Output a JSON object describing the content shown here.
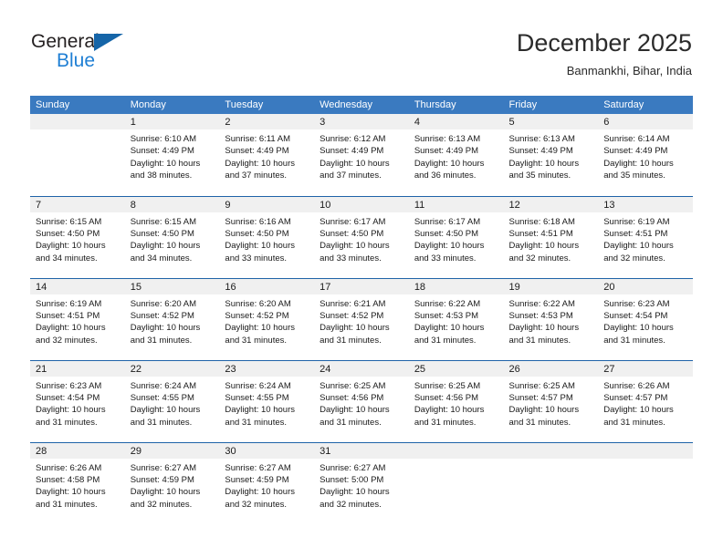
{
  "logo": {
    "word_one": "General",
    "word_two": "Blue",
    "triangle_icon": "blue-triangle-icon",
    "brand_blue": "#1f7fd4",
    "triangle_color": "#1565a8"
  },
  "header": {
    "title": "December 2025",
    "subtitle": "Banmankhi, Bihar, India"
  },
  "theme": {
    "header_row_bg": "#3a7ac0",
    "row_divider": "#1f63a8",
    "daynum_bg": "#f0f0f0",
    "text": "#1a1a1a"
  },
  "calendar": {
    "weekday_headers": [
      "Sunday",
      "Monday",
      "Tuesday",
      "Wednesday",
      "Thursday",
      "Friday",
      "Saturday"
    ],
    "weeks": [
      [
        {
          "day": "",
          "sunrise": "",
          "sunset": "",
          "daylight_line1": "",
          "daylight_line2": "",
          "empty": true
        },
        {
          "day": "1",
          "sunrise": "Sunrise: 6:10 AM",
          "sunset": "Sunset: 4:49 PM",
          "daylight_line1": "Daylight: 10 hours",
          "daylight_line2": "and 38 minutes.",
          "empty": false
        },
        {
          "day": "2",
          "sunrise": "Sunrise: 6:11 AM",
          "sunset": "Sunset: 4:49 PM",
          "daylight_line1": "Daylight: 10 hours",
          "daylight_line2": "and 37 minutes.",
          "empty": false
        },
        {
          "day": "3",
          "sunrise": "Sunrise: 6:12 AM",
          "sunset": "Sunset: 4:49 PM",
          "daylight_line1": "Daylight: 10 hours",
          "daylight_line2": "and 37 minutes.",
          "empty": false
        },
        {
          "day": "4",
          "sunrise": "Sunrise: 6:13 AM",
          "sunset": "Sunset: 4:49 PM",
          "daylight_line1": "Daylight: 10 hours",
          "daylight_line2": "and 36 minutes.",
          "empty": false
        },
        {
          "day": "5",
          "sunrise": "Sunrise: 6:13 AM",
          "sunset": "Sunset: 4:49 PM",
          "daylight_line1": "Daylight: 10 hours",
          "daylight_line2": "and 35 minutes.",
          "empty": false
        },
        {
          "day": "6",
          "sunrise": "Sunrise: 6:14 AM",
          "sunset": "Sunset: 4:49 PM",
          "daylight_line1": "Daylight: 10 hours",
          "daylight_line2": "and 35 minutes.",
          "empty": false
        }
      ],
      [
        {
          "day": "7",
          "sunrise": "Sunrise: 6:15 AM",
          "sunset": "Sunset: 4:50 PM",
          "daylight_line1": "Daylight: 10 hours",
          "daylight_line2": "and 34 minutes.",
          "empty": false
        },
        {
          "day": "8",
          "sunrise": "Sunrise: 6:15 AM",
          "sunset": "Sunset: 4:50 PM",
          "daylight_line1": "Daylight: 10 hours",
          "daylight_line2": "and 34 minutes.",
          "empty": false
        },
        {
          "day": "9",
          "sunrise": "Sunrise: 6:16 AM",
          "sunset": "Sunset: 4:50 PM",
          "daylight_line1": "Daylight: 10 hours",
          "daylight_line2": "and 33 minutes.",
          "empty": false
        },
        {
          "day": "10",
          "sunrise": "Sunrise: 6:17 AM",
          "sunset": "Sunset: 4:50 PM",
          "daylight_line1": "Daylight: 10 hours",
          "daylight_line2": "and 33 minutes.",
          "empty": false
        },
        {
          "day": "11",
          "sunrise": "Sunrise: 6:17 AM",
          "sunset": "Sunset: 4:50 PM",
          "daylight_line1": "Daylight: 10 hours",
          "daylight_line2": "and 33 minutes.",
          "empty": false
        },
        {
          "day": "12",
          "sunrise": "Sunrise: 6:18 AM",
          "sunset": "Sunset: 4:51 PM",
          "daylight_line1": "Daylight: 10 hours",
          "daylight_line2": "and 32 minutes.",
          "empty": false
        },
        {
          "day": "13",
          "sunrise": "Sunrise: 6:19 AM",
          "sunset": "Sunset: 4:51 PM",
          "daylight_line1": "Daylight: 10 hours",
          "daylight_line2": "and 32 minutes.",
          "empty": false
        }
      ],
      [
        {
          "day": "14",
          "sunrise": "Sunrise: 6:19 AM",
          "sunset": "Sunset: 4:51 PM",
          "daylight_line1": "Daylight: 10 hours",
          "daylight_line2": "and 32 minutes.",
          "empty": false
        },
        {
          "day": "15",
          "sunrise": "Sunrise: 6:20 AM",
          "sunset": "Sunset: 4:52 PM",
          "daylight_line1": "Daylight: 10 hours",
          "daylight_line2": "and 31 minutes.",
          "empty": false
        },
        {
          "day": "16",
          "sunrise": "Sunrise: 6:20 AM",
          "sunset": "Sunset: 4:52 PM",
          "daylight_line1": "Daylight: 10 hours",
          "daylight_line2": "and 31 minutes.",
          "empty": false
        },
        {
          "day": "17",
          "sunrise": "Sunrise: 6:21 AM",
          "sunset": "Sunset: 4:52 PM",
          "daylight_line1": "Daylight: 10 hours",
          "daylight_line2": "and 31 minutes.",
          "empty": false
        },
        {
          "day": "18",
          "sunrise": "Sunrise: 6:22 AM",
          "sunset": "Sunset: 4:53 PM",
          "daylight_line1": "Daylight: 10 hours",
          "daylight_line2": "and 31 minutes.",
          "empty": false
        },
        {
          "day": "19",
          "sunrise": "Sunrise: 6:22 AM",
          "sunset": "Sunset: 4:53 PM",
          "daylight_line1": "Daylight: 10 hours",
          "daylight_line2": "and 31 minutes.",
          "empty": false
        },
        {
          "day": "20",
          "sunrise": "Sunrise: 6:23 AM",
          "sunset": "Sunset: 4:54 PM",
          "daylight_line1": "Daylight: 10 hours",
          "daylight_line2": "and 31 minutes.",
          "empty": false
        }
      ],
      [
        {
          "day": "21",
          "sunrise": "Sunrise: 6:23 AM",
          "sunset": "Sunset: 4:54 PM",
          "daylight_line1": "Daylight: 10 hours",
          "daylight_line2": "and 31 minutes.",
          "empty": false
        },
        {
          "day": "22",
          "sunrise": "Sunrise: 6:24 AM",
          "sunset": "Sunset: 4:55 PM",
          "daylight_line1": "Daylight: 10 hours",
          "daylight_line2": "and 31 minutes.",
          "empty": false
        },
        {
          "day": "23",
          "sunrise": "Sunrise: 6:24 AM",
          "sunset": "Sunset: 4:55 PM",
          "daylight_line1": "Daylight: 10 hours",
          "daylight_line2": "and 31 minutes.",
          "empty": false
        },
        {
          "day": "24",
          "sunrise": "Sunrise: 6:25 AM",
          "sunset": "Sunset: 4:56 PM",
          "daylight_line1": "Daylight: 10 hours",
          "daylight_line2": "and 31 minutes.",
          "empty": false
        },
        {
          "day": "25",
          "sunrise": "Sunrise: 6:25 AM",
          "sunset": "Sunset: 4:56 PM",
          "daylight_line1": "Daylight: 10 hours",
          "daylight_line2": "and 31 minutes.",
          "empty": false
        },
        {
          "day": "26",
          "sunrise": "Sunrise: 6:25 AM",
          "sunset": "Sunset: 4:57 PM",
          "daylight_line1": "Daylight: 10 hours",
          "daylight_line2": "and 31 minutes.",
          "empty": false
        },
        {
          "day": "27",
          "sunrise": "Sunrise: 6:26 AM",
          "sunset": "Sunset: 4:57 PM",
          "daylight_line1": "Daylight: 10 hours",
          "daylight_line2": "and 31 minutes.",
          "empty": false
        }
      ],
      [
        {
          "day": "28",
          "sunrise": "Sunrise: 6:26 AM",
          "sunset": "Sunset: 4:58 PM",
          "daylight_line1": "Daylight: 10 hours",
          "daylight_line2": "and 31 minutes.",
          "empty": false
        },
        {
          "day": "29",
          "sunrise": "Sunrise: 6:27 AM",
          "sunset": "Sunset: 4:59 PM",
          "daylight_line1": "Daylight: 10 hours",
          "daylight_line2": "and 32 minutes.",
          "empty": false
        },
        {
          "day": "30",
          "sunrise": "Sunrise: 6:27 AM",
          "sunset": "Sunset: 4:59 PM",
          "daylight_line1": "Daylight: 10 hours",
          "daylight_line2": "and 32 minutes.",
          "empty": false
        },
        {
          "day": "31",
          "sunrise": "Sunrise: 6:27 AM",
          "sunset": "Sunset: 5:00 PM",
          "daylight_line1": "Daylight: 10 hours",
          "daylight_line2": "and 32 minutes.",
          "empty": false
        },
        {
          "day": "",
          "sunrise": "",
          "sunset": "",
          "daylight_line1": "",
          "daylight_line2": "",
          "empty": true
        },
        {
          "day": "",
          "sunrise": "",
          "sunset": "",
          "daylight_line1": "",
          "daylight_line2": "",
          "empty": true
        },
        {
          "day": "",
          "sunrise": "",
          "sunset": "",
          "daylight_line1": "",
          "daylight_line2": "",
          "empty": true
        }
      ]
    ]
  }
}
